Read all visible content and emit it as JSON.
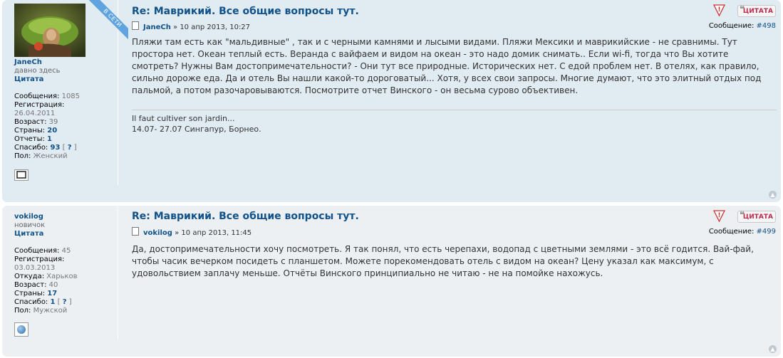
{
  "posts": [
    {
      "title": "Re: Маврикий. Все общие вопросы тут.",
      "author": "JaneCh",
      "date": "» 10 апр 2013, 10:27",
      "msg_label": "Сообщение:",
      "msg_num": "#498",
      "online_badge": "В СЕТИ",
      "profile": {
        "username": "JaneCh",
        "rank": "давно здесь",
        "quote_link": "Цитата",
        "messages_label": "Сообщения:",
        "messages": "1085",
        "reg_label": "Регистрация:",
        "reg": "26.04.2011",
        "age_label": "Возраст:",
        "age": "39",
        "countries_label": "Страны:",
        "countries": "20",
        "reports_label": "Отчеты:",
        "reports": "1",
        "thanks_label": "Спасибо:",
        "thanks": "93",
        "thanks_q": "?",
        "gender_label": "Пол:",
        "gender": "Женский"
      },
      "text": "Пляжи там есть как \"мальдивные\" , так и с черными камнями и лысыми видами. Пляжи Мексики и маврикийские - не сравнимы. Тут простора нет. Океан теплый есть. Веранда с вайфаем и видом на океан - это надо домик снимать.. Если wi-fi, тогда что Вы хотите смотреть? Нужны Вам достопримечательности? - Они тут все природные. Исторических нет. С едой проблем нет. В отелях, как правило, сильно дороже еда. Да и отель Вы нашли какой-то дороговатый... Хотя, у всех свои запросы. Многие думают, что это элитный отдых под пальмой, а потом разочаровываются. Посмотрите отчет Винского - он весьма сурово объективен.",
      "signature": [
        "Il faut cultiver son jardin...",
        "14.07- 27.07 Сингапур, Борнео."
      ]
    },
    {
      "title": "Re: Маврикий. Все общие вопросы тут.",
      "author": "vokilog",
      "date": "» 10 апр 2013, 11:45",
      "msg_label": "Сообщение:",
      "msg_num": "#499",
      "profile": {
        "username": "vokilog",
        "rank": "новичок",
        "quote_link": "Цитата",
        "messages_label": "Сообщения:",
        "messages": "45",
        "reg_label": "Регистрация:",
        "reg": "03.03.2013",
        "from_label": "Откуда:",
        "from": "Харьков",
        "age_label": "Возраст:",
        "age": "40",
        "countries_label": "Страны:",
        "countries": "17",
        "thanks_label": "Спасибо:",
        "thanks": "1",
        "thanks_q": "?",
        "gender_label": "Пол:",
        "gender": "Мужской"
      },
      "text": "Да, достопримечательности хочу посмотреть. Я так понял, что есть черепахи, водопад с цветными землями - это всё годится. Вай-фай, чтобы часик вечерком посидеть с планшетом. Можете порекомендовать отель с видом на океан? Цену указал как максимум, с удовольствием заплачу меньше. Отчёты Винского принципиально не читаю - не на помойке нахожусь."
    }
  ],
  "buttons": {
    "report_icon": "!",
    "quote_label": "ЦИТАТА",
    "top_icon": "▲"
  },
  "icons": [
    "report-icon",
    "quote-icon",
    "document-icon",
    "top-icon",
    "pm-icon",
    "globe-icon"
  ],
  "colors": {
    "post1_bg": "#e1ebf2",
    "post2_bg": "#ecf0f3",
    "link": "#105289",
    "quote_red": "#bc2a4d"
  }
}
